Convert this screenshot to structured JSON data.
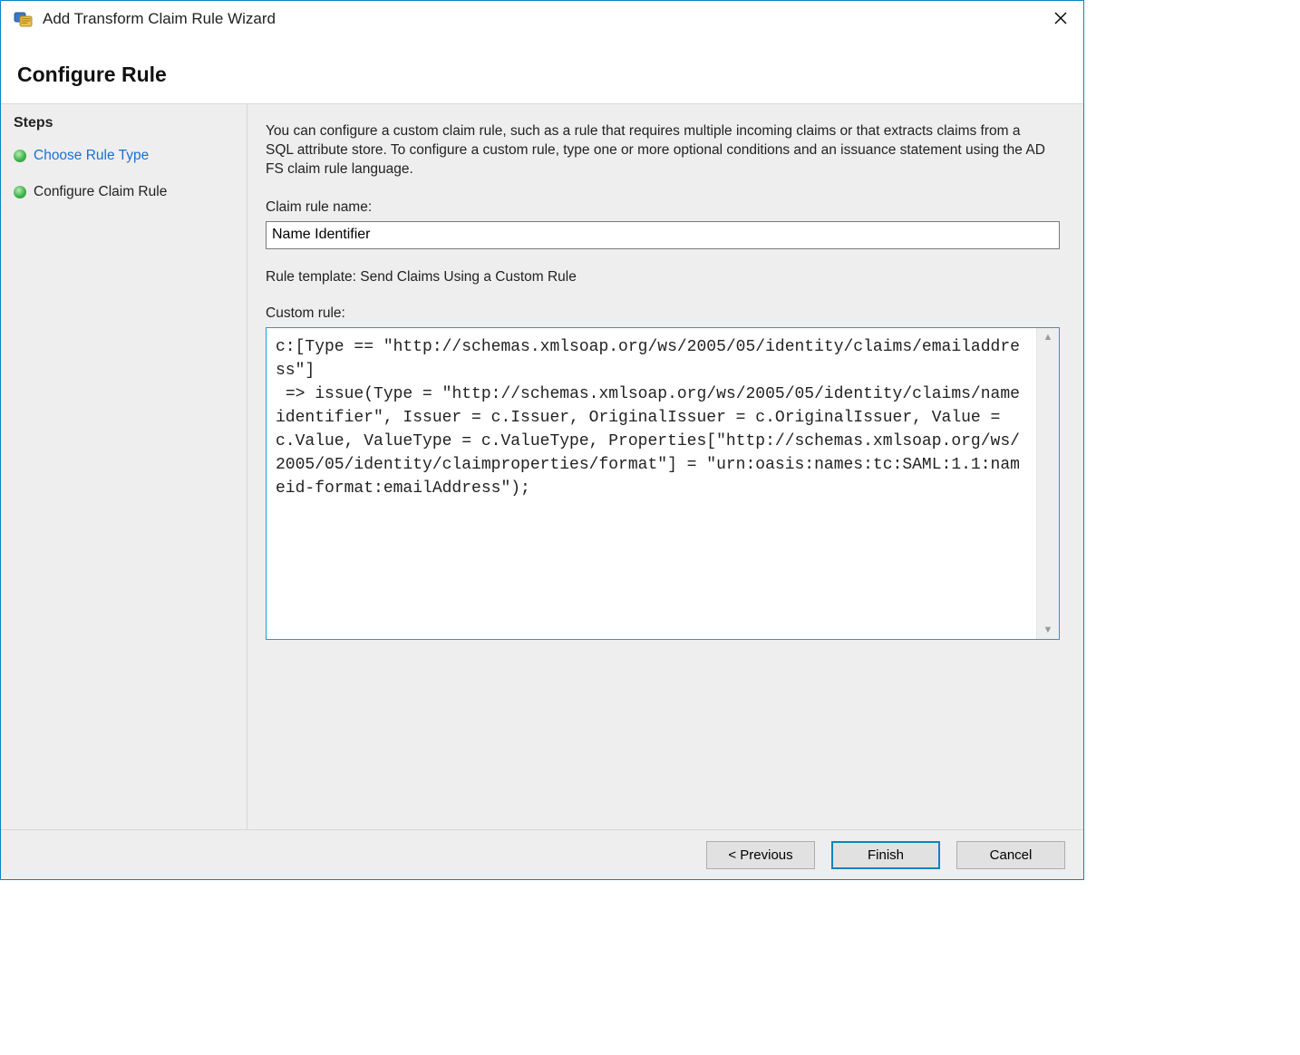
{
  "window": {
    "title": "Add Transform Claim Rule Wizard"
  },
  "header": {
    "title": "Configure Rule"
  },
  "sidebar": {
    "title": "Steps",
    "items": [
      {
        "label": "Choose Rule Type"
      },
      {
        "label": "Configure Claim Rule"
      }
    ]
  },
  "main": {
    "intro": "You can configure a custom claim rule, such as a rule that requires multiple incoming claims or that extracts claims from a SQL attribute store. To configure a custom rule, type one or more optional conditions and an issuance statement using the AD FS claim rule language.",
    "name_label": "Claim rule name:",
    "name_value": "Name Identifier",
    "template_label": "Rule template: Send Claims Using a Custom Rule",
    "custom_label": "Custom rule:",
    "custom_value": "c:[Type == \"http://schemas.xmlsoap.org/ws/2005/05/identity/claims/emailaddress\"]\n => issue(Type = \"http://schemas.xmlsoap.org/ws/2005/05/identity/claims/nameidentifier\", Issuer = c.Issuer, OriginalIssuer = c.OriginalIssuer, Value = c.Value, ValueType = c.ValueType, Properties[\"http://schemas.xmlsoap.org/ws/2005/05/identity/claimproperties/format\"] = \"urn:oasis:names:tc:SAML:1.1:nameid-format:emailAddress\");"
  },
  "footer": {
    "previous": "< Previous",
    "finish": "Finish",
    "cancel": "Cancel"
  },
  "icons": {
    "window_icon": "wizard-icon",
    "close": "close-icon"
  }
}
